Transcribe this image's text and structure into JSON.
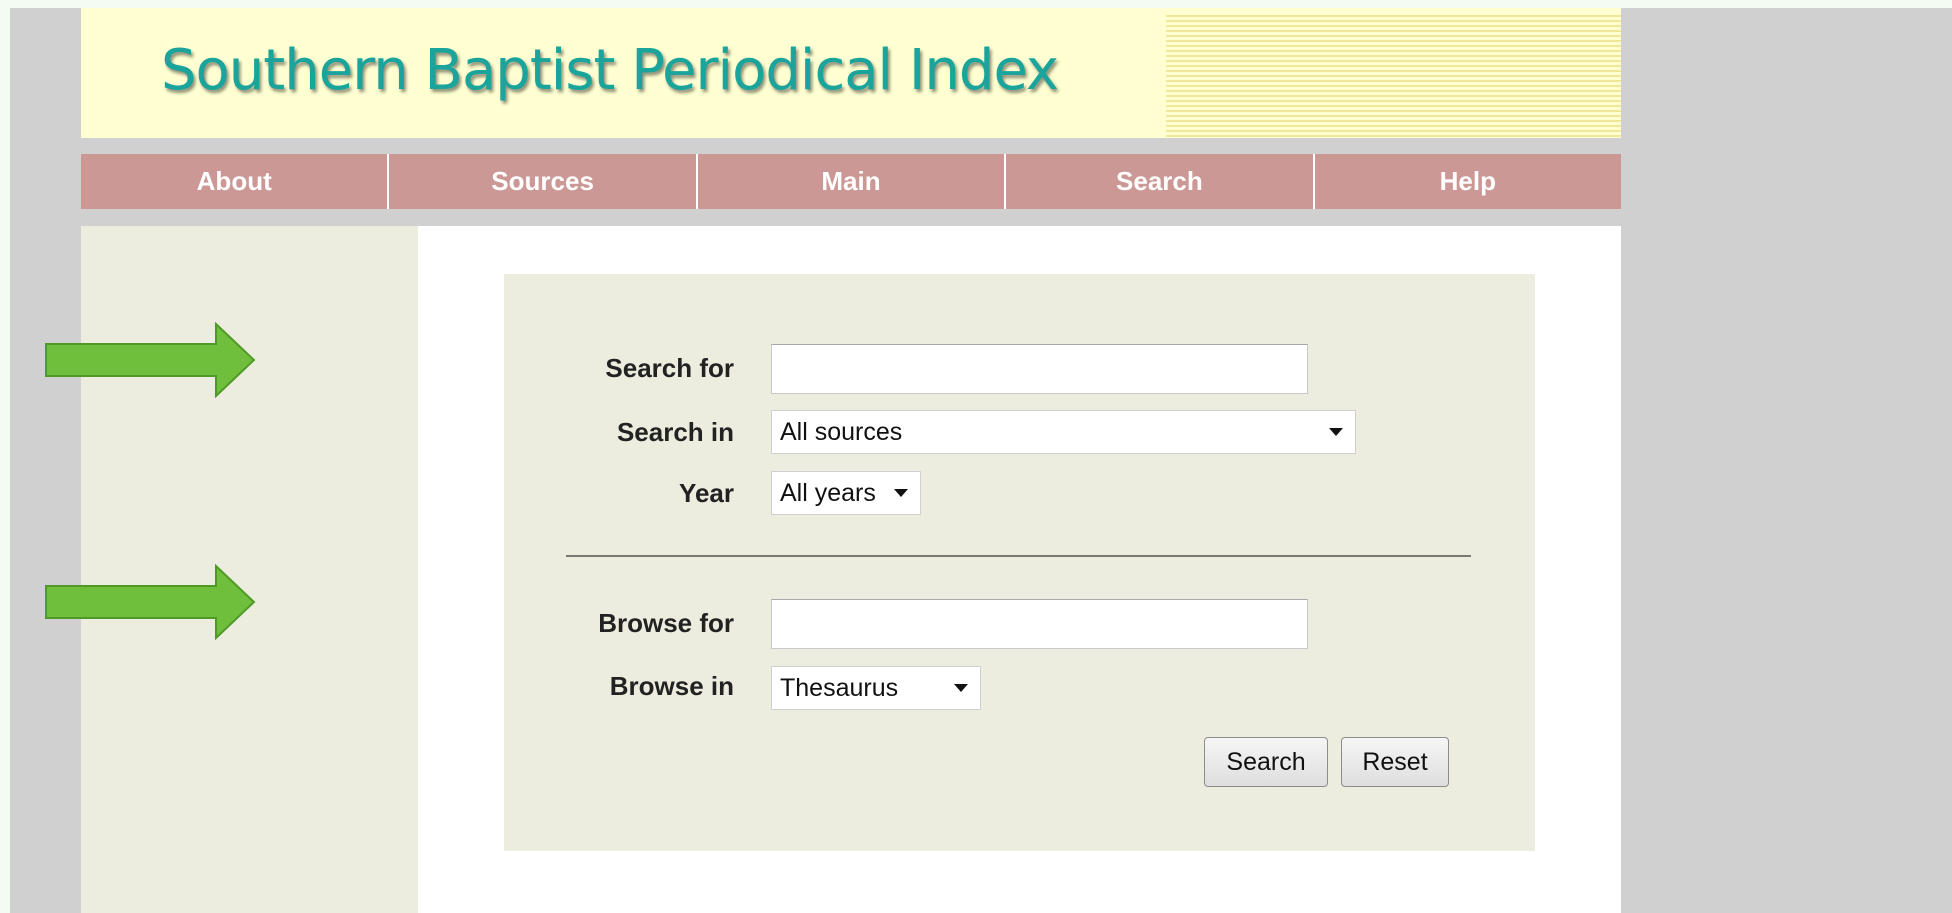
{
  "banner": {
    "title": "Southern Baptist Periodical Index"
  },
  "nav": {
    "items": [
      {
        "label": "About"
      },
      {
        "label": "Sources"
      },
      {
        "label": "Main"
      },
      {
        "label": "Search"
      },
      {
        "label": "Help"
      }
    ]
  },
  "search_form": {
    "search_for_label": "Search for",
    "search_for_value": "",
    "search_in_label": "Search in",
    "search_in_selected": "All sources",
    "year_label": "Year",
    "year_selected": "All years",
    "browse_for_label": "Browse for",
    "browse_for_value": "",
    "browse_in_label": "Browse in",
    "browse_in_selected": "Thesaurus",
    "search_button": "Search",
    "reset_button": "Reset"
  },
  "annotations": {
    "arrow_color": "#6fbf3c",
    "arrow_count": 2
  },
  "colors": {
    "banner_bg": "#ffffd2",
    "title_color": "#1aa49b",
    "nav_bg": "#cc9896",
    "panel_bg": "#ededdf"
  }
}
